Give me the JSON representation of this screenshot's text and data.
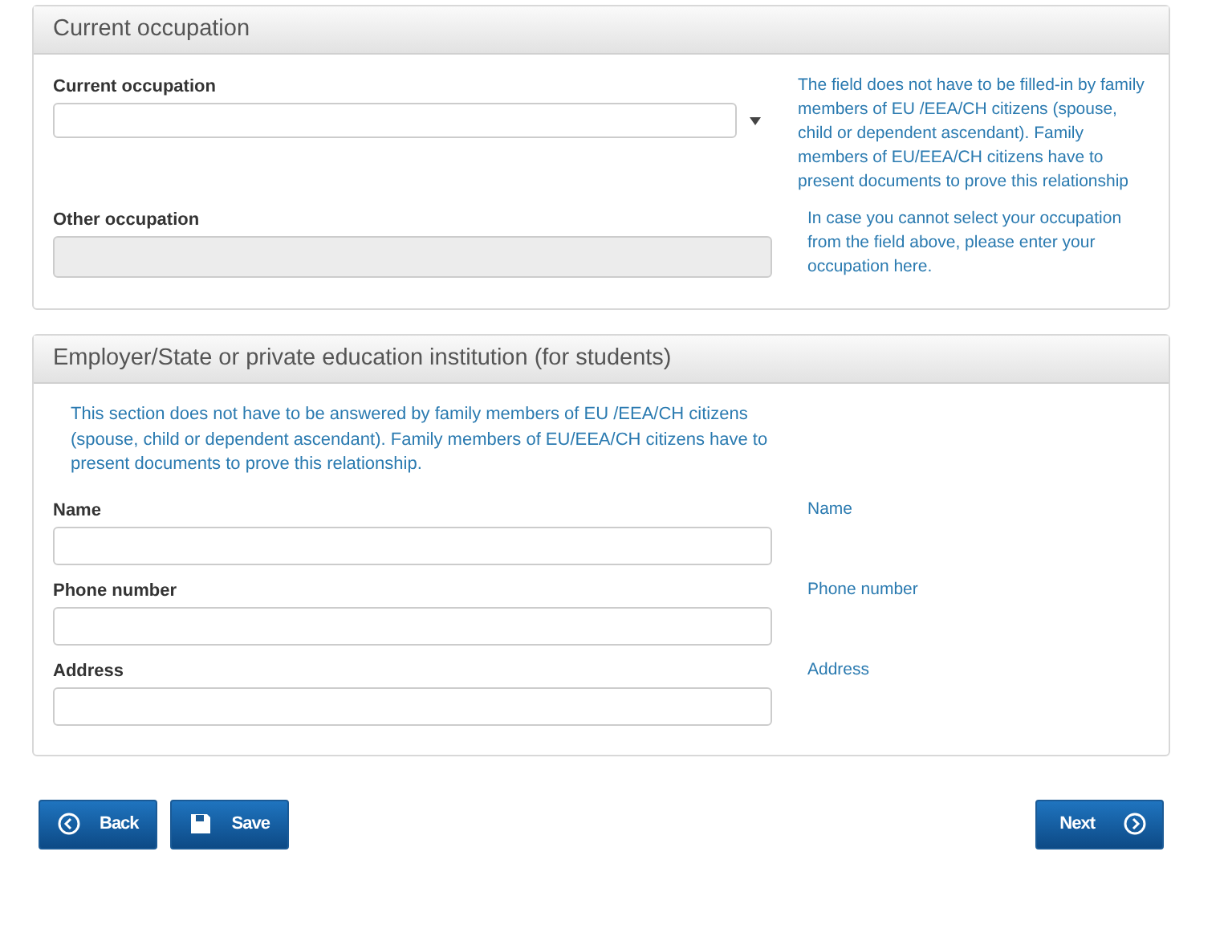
{
  "sections": [
    {
      "title": "Current occupation",
      "fields": [
        {
          "kind": "select",
          "label": "Current occupation",
          "disabled": false,
          "hint": "The field does not have to be filled-in by family members of EU /EEA/CH citizens (spouse, child or dependent ascendant). Family members of EU/EEA/CH citizens have to present documents to prove this relationship"
        },
        {
          "kind": "text",
          "label": "Other occupation",
          "disabled": true,
          "hint": "In case you cannot select your occupation from the field above, please enter your occupation here."
        }
      ]
    },
    {
      "title": "Employer/State or private education institution (for students)",
      "note": "This section does not have to be answered by family members of EU /EEA/CH citizens (spouse, child or dependent ascendant). Family members of EU/EEA/CH citizens have to present documents to prove this relationship.",
      "fields": [
        {
          "kind": "text",
          "label": "Name",
          "disabled": false,
          "hint": "Name"
        },
        {
          "kind": "text",
          "label": "Phone number",
          "disabled": false,
          "hint": "Phone number"
        },
        {
          "kind": "text",
          "label": "Address",
          "disabled": false,
          "hint": "Address"
        }
      ]
    }
  ],
  "buttons": [
    {
      "kind": "back",
      "label": "Back"
    },
    {
      "kind": "save",
      "label": "Save"
    },
    {
      "kind": "next",
      "label": "Next"
    }
  ]
}
